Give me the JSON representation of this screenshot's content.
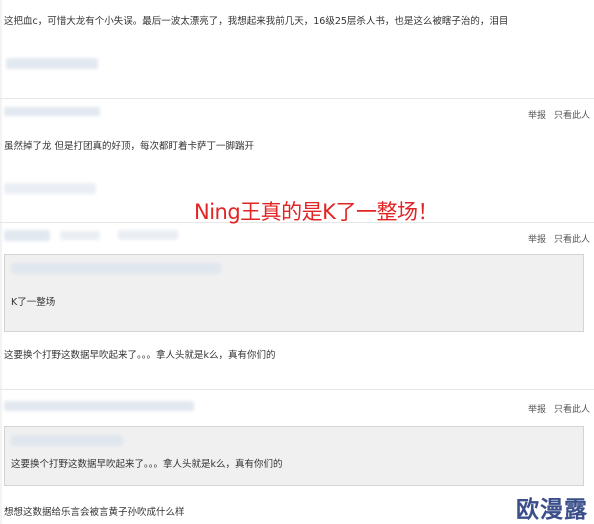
{
  "comments": [
    {
      "text": "这把血c，可惜大龙有个小失误。最后一波太漂亮了，我想起来我前几天，16级25层杀人书，也是这么被瞎子治的，泪目"
    },
    {
      "text": "虽然掉了龙 但是打团真的好顶，每次都盯着卡萨丁一脚踹开"
    },
    {
      "quote_text": "K了一整场",
      "text": "这要换个打野这数据早吹起来了。。。拿人头就是k么，真有你们的"
    },
    {
      "quote_text": "这要换个打野这数据早吹起来了。。。拿人头就是k么，真有你们的",
      "text": "想想这数据给乐言会被言黄子孙吹成什么样"
    }
  ],
  "actions": {
    "report": "举报",
    "only_this": "只看此人"
  },
  "overlay_caption": "Ning王真的是K了一整场！",
  "watermark": "欧漫露",
  "colors": {
    "caption": "#e22424",
    "watermark": "#3a4f8a",
    "quote_bg": "#f0f0f0"
  }
}
